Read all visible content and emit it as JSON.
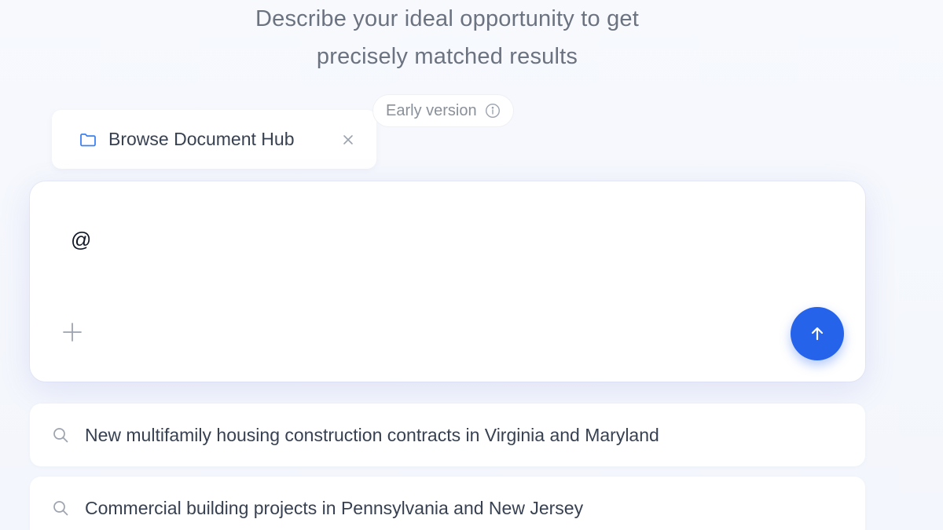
{
  "headline": {
    "line1": "Describe your ideal opportunity to get",
    "line2": "precisely matched results"
  },
  "badge": {
    "label": "Early version",
    "icon": "info-icon"
  },
  "doc_tab": {
    "label": "Browse Document Hub",
    "icon": "folder-icon",
    "close_icon": "close-icon"
  },
  "prompt": {
    "value": "@",
    "placeholder": "",
    "add_icon": "plus-icon",
    "send_icon": "arrow-up-icon"
  },
  "suggestions": [
    {
      "text": "New multifamily housing construction contracts in Virginia and Maryland",
      "icon": "search-icon"
    },
    {
      "text": "Commercial building projects in Pennsylvania and New Jersey",
      "icon": "search-icon"
    }
  ],
  "colors": {
    "accent": "#2563eb",
    "folder": "#3b82f6",
    "muted_text": "#6b7280",
    "body_text": "#374151"
  }
}
